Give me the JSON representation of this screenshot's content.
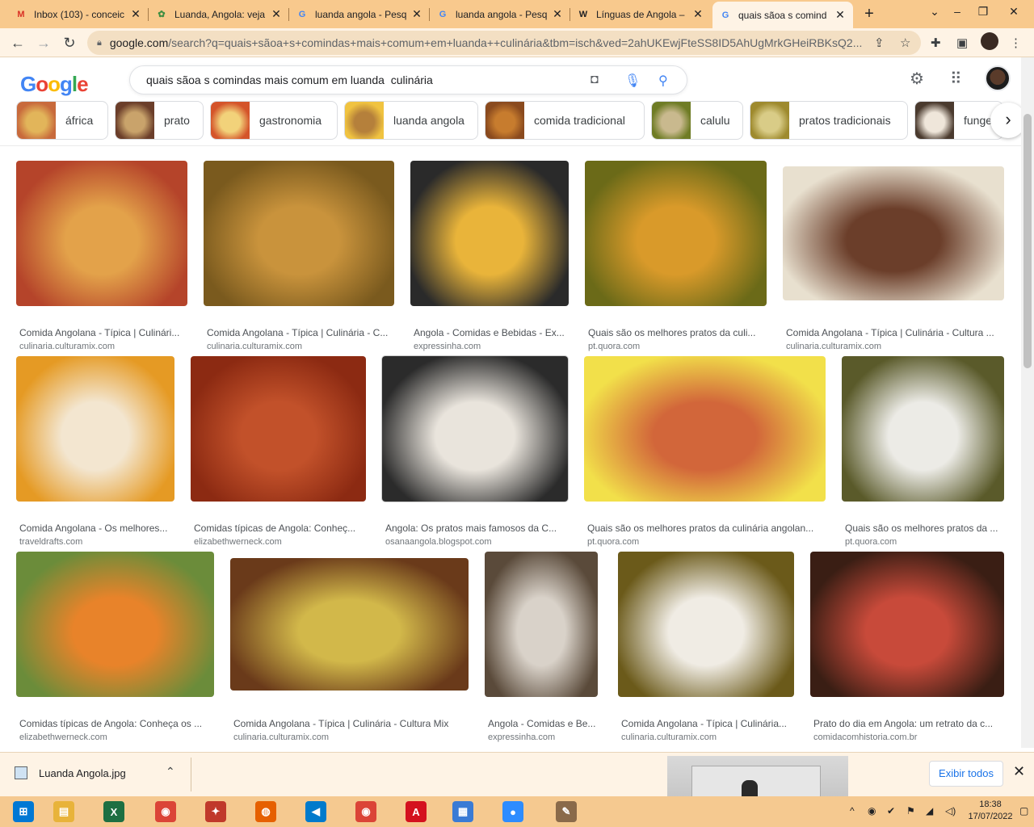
{
  "tabs": [
    {
      "title": "Inbox (103) - conceic",
      "icon": "gmail-icon",
      "color": "#d93025",
      "glyph": "M"
    },
    {
      "title": "Luanda, Angola: veja",
      "icon": "leaf-icon",
      "color": "#3e8e41",
      "glyph": "✿"
    },
    {
      "title": "luanda angola - Pesq",
      "icon": "google-icon",
      "color": "#4285f4",
      "glyph": "G"
    },
    {
      "title": "luanda angola - Pesq",
      "icon": "google-icon",
      "color": "#4285f4",
      "glyph": "G"
    },
    {
      "title": "Línguas de Angola –",
      "icon": "wikipedia-icon",
      "color": "#202124",
      "glyph": "W"
    },
    {
      "title": "quais sãoa s comind",
      "icon": "google-icon",
      "color": "#4285f4",
      "glyph": "G"
    }
  ],
  "address": {
    "host": "google.com",
    "path": "/search?q=quais+sãoa+s+comindas+mais+comum+em+luanda++culinária&tbm=isch&ved=2ahUKEwjFteSS8ID5AhUgMrkGHeiRBKsQ2..."
  },
  "search": {
    "query": "quais sãoa s comindas mais comum em luanda  culinária",
    "logo": "Google"
  },
  "chips": [
    {
      "label": "áfrica",
      "c1": "#c86a3c",
      "c2": "#e2b55a"
    },
    {
      "label": "prato",
      "c1": "#6b3e2a",
      "c2": "#c9a36b"
    },
    {
      "label": "gastronomia",
      "c1": "#d4542a",
      "c2": "#f2d27a"
    },
    {
      "label": "luanda angola",
      "c1": "#f0c340",
      "c2": "#b5803b"
    },
    {
      "label": "comida tradicional",
      "c1": "#8a4a1e",
      "c2": "#c77c2e"
    },
    {
      "label": "calulu",
      "c1": "#6f7c25",
      "c2": "#c9b98e"
    },
    {
      "label": "pratos tradicionais",
      "c1": "#9e8a2e",
      "c2": "#d9cc87"
    },
    {
      "label": "funge",
      "c1": "#4a3a2e",
      "c2": "#efe6da"
    }
  ],
  "results": [
    {
      "title": "Comida Angolana - Típica | Culinári...",
      "source": "culinaria.culturamix.com",
      "c1": "#b5442a",
      "c2": "#e3a24a"
    },
    {
      "title": "Comida Angolana - Típica | Culinária - C...",
      "source": "culinaria.culturamix.com",
      "c1": "#7a5a1e",
      "c2": "#c9933c"
    },
    {
      "title": "Angola - Comidas e Bebidas - Ex...",
      "source": "expressinha.com",
      "c1": "#2a2a2a",
      "c2": "#e9b43a"
    },
    {
      "title": "Quais são os melhores pratos da culi...",
      "source": "pt.quora.com",
      "c1": "#6b6a18",
      "c2": "#d99a2a"
    },
    {
      "title": "Comida Angolana - Típica | Culinária - Cultura ...",
      "source": "culinaria.culturamix.com",
      "c1": "#e8e0cf",
      "c2": "#6b3e2a"
    },
    {
      "title": "Comida Angolana - Os melhores...",
      "source": "traveldrafts.com",
      "c1": "#e59a24",
      "c2": "#f3e6d0"
    },
    {
      "title": "Comidas típicas de Angola: Conheç...",
      "source": "elizabethwerneck.com",
      "c1": "#8c2a12",
      "c2": "#c2512a"
    },
    {
      "title": "Angola: Os pratos mais famosos da C...",
      "source": "osanaangola.blogspot.com",
      "c1": "#2b2b2b",
      "c2": "#e9e4dc"
    },
    {
      "title": "Quais são os melhores pratos da culinária angolan...",
      "source": "pt.quora.com",
      "c1": "#f2e04a",
      "c2": "#d2663a"
    },
    {
      "title": "Quais são os melhores pratos da ...",
      "source": "pt.quora.com",
      "c1": "#5a5a2a",
      "c2": "#ecebe6"
    },
    {
      "title": "Comidas típicas de Angola: Conheça os ...",
      "source": "elizabethwerneck.com",
      "c1": "#6b8c3a",
      "c2": "#e8832a"
    },
    {
      "title": "Comida Angolana - Típica | Culinária - Cultura Mix",
      "source": "culinaria.culturamix.com",
      "c1": "#6a3a1a",
      "c2": "#d2b84a"
    },
    {
      "title": "Angola - Comidas e Be...",
      "source": "expressinha.com",
      "c1": "#5a4a3a",
      "c2": "#d9d2c9"
    },
    {
      "title": "Comida Angolana - Típica | Culinária...",
      "source": "culinaria.culturamix.com",
      "c1": "#6b5a1a",
      "c2": "#f0ece4"
    },
    {
      "title": "Prato do dia em Angola: um retrato da c...",
      "source": "comidacomhistoria.com.br",
      "c1": "#3a1e14",
      "c2": "#c84a3a"
    }
  ],
  "download": {
    "filename": "Luanda Angola.jpg",
    "show_all": "Exibir todos"
  },
  "taskbar": {
    "apps": [
      {
        "icon": "start-icon",
        "color": "#0078d4",
        "glyph": "⊞"
      },
      {
        "icon": "file-explorer-icon",
        "color": "#e8b33a",
        "glyph": "▤"
      },
      {
        "icon": "excel-icon",
        "color": "#1d6f42",
        "glyph": "X"
      },
      {
        "icon": "chrome-icon",
        "color": "#db4437",
        "glyph": "◉"
      },
      {
        "icon": "app-icon",
        "color": "#c0392b",
        "glyph": "✦"
      },
      {
        "icon": "firefox-icon",
        "color": "#e66000",
        "glyph": "◍"
      },
      {
        "icon": "vscode-icon",
        "color": "#007acc",
        "glyph": "◀"
      },
      {
        "icon": "chrome-icon",
        "color": "#db4437",
        "glyph": "◉"
      },
      {
        "icon": "acrobat-icon",
        "color": "#d4111e",
        "glyph": "A"
      },
      {
        "icon": "photos-icon",
        "color": "#3a7bd5",
        "glyph": "▦"
      },
      {
        "icon": "zoom-icon",
        "color": "#2d8cff",
        "glyph": "●"
      },
      {
        "icon": "paint-icon",
        "color": "#8a6a4a",
        "glyph": "✎"
      }
    ],
    "time": "18:38",
    "date": "17/07/2022"
  }
}
